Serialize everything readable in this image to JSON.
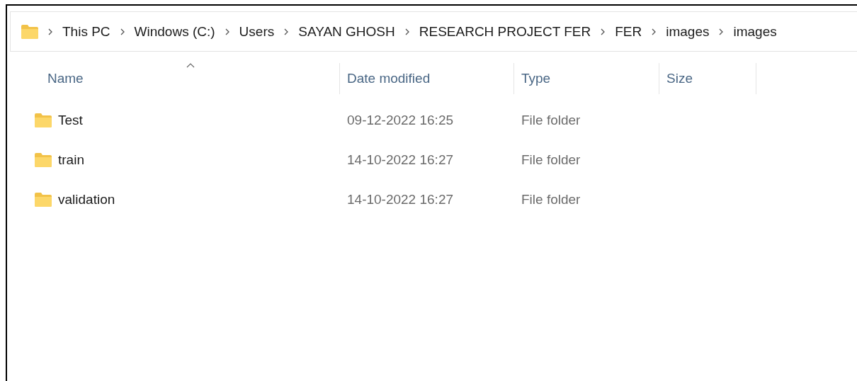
{
  "breadcrumb": [
    "This PC",
    "Windows (C:)",
    "Users",
    "SAYAN GHOSH",
    "RESEARCH PROJECT FER",
    "FER",
    "images",
    "images"
  ],
  "columns": [
    {
      "label": "Name",
      "sorted": true
    },
    {
      "label": "Date modified",
      "sorted": false
    },
    {
      "label": "Type",
      "sorted": false
    },
    {
      "label": "Size",
      "sorted": false
    }
  ],
  "rows": [
    {
      "name": "Test",
      "date_modified": "09-12-2022 16:25",
      "type": "File folder"
    },
    {
      "name": "train",
      "date_modified": "14-10-2022 16:27",
      "type": "File folder"
    },
    {
      "name": "validation",
      "date_modified": "14-10-2022 16:27",
      "type": "File folder"
    }
  ]
}
